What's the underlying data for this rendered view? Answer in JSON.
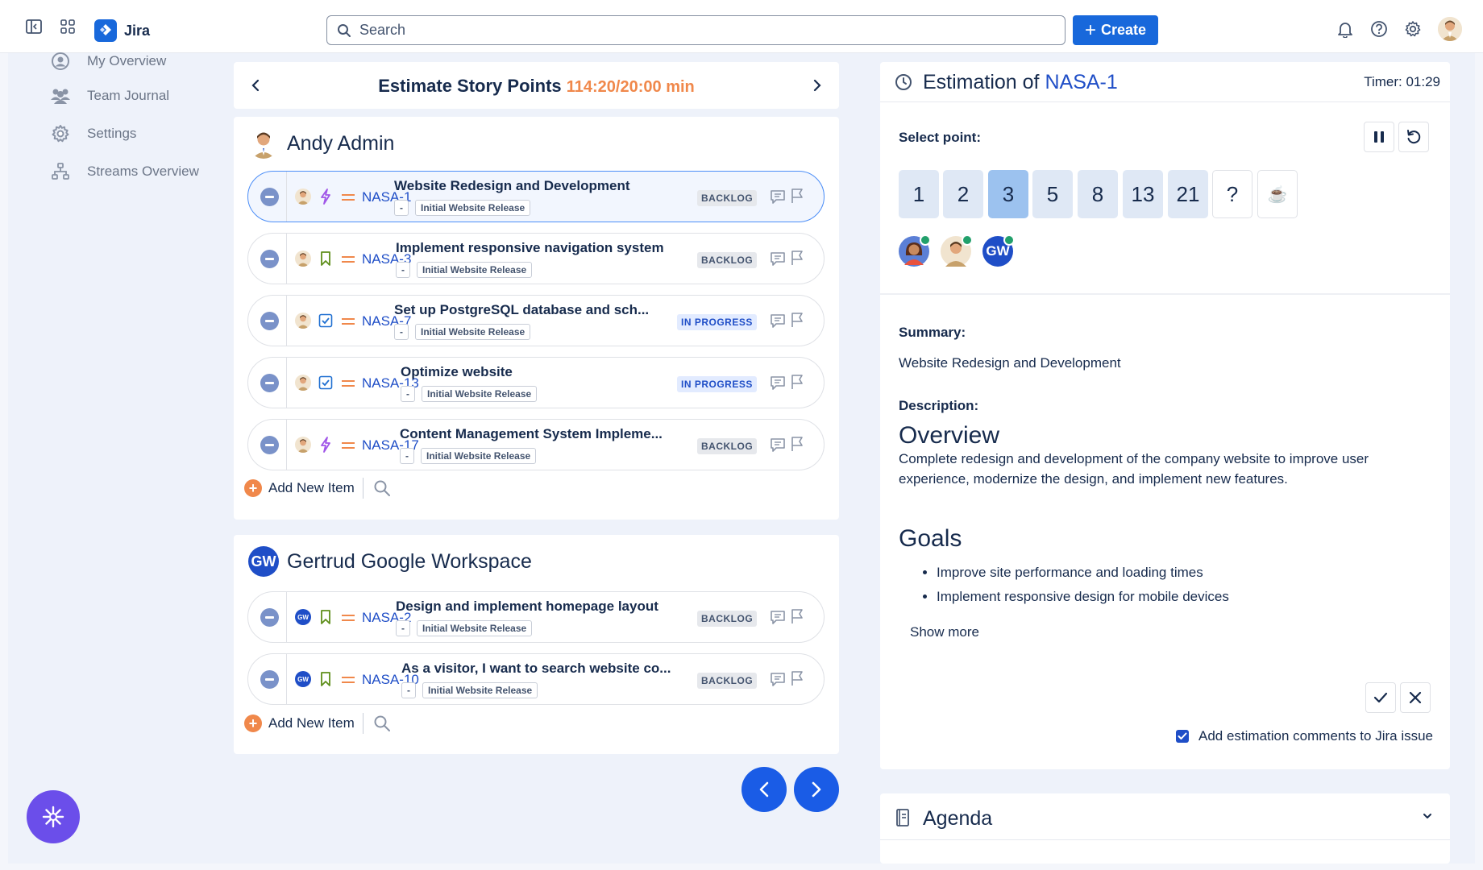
{
  "topbar": {
    "app_name": "Jira",
    "search_placeholder": "Search",
    "create_label": "Create"
  },
  "nav": {
    "items": [
      {
        "label": "My Overview",
        "icon": "person-circle-icon"
      },
      {
        "label": "Team Journal",
        "icon": "team-icon"
      },
      {
        "label": "Settings",
        "icon": "gear-icon"
      },
      {
        "label": "Streams Overview",
        "icon": "hierarchy-icon"
      }
    ]
  },
  "estimate": {
    "title": "Estimate Story Points",
    "timer": "114:20/20:00 min"
  },
  "groups": [
    {
      "name": "Andy Admin",
      "avatar": "andy",
      "add_label": "Add New Item",
      "rows": [
        {
          "key": "NASA-1",
          "summary": "Website Redesign and Development",
          "type": "epic",
          "chip1": "-",
          "chip2": "Initial Website Release",
          "status": "BACKLOG"
        },
        {
          "key": "NASA-3",
          "summary": "Implement responsive navigation system",
          "type": "story",
          "chip1": "-",
          "chip2": "Initial Website Release",
          "status": "BACKLOG"
        },
        {
          "key": "NASA-7",
          "summary": "Set up PostgreSQL database and sch...",
          "type": "task",
          "chip1": "-",
          "chip2": "Initial Website Release",
          "status": "IN PROGRESS"
        },
        {
          "key": "NASA-13",
          "summary": "Optimize website",
          "type": "task",
          "chip1": "-",
          "chip2": "Initial Website Release",
          "status": "IN PROGRESS"
        },
        {
          "key": "NASA-17",
          "summary": "Content Management System Impleme...",
          "type": "epic",
          "chip1": "-",
          "chip2": "Initial Website Release",
          "status": "BACKLOG"
        }
      ]
    },
    {
      "name": "Gertrud Google Workspace",
      "avatar_initials": "GW",
      "add_label": "Add New Item",
      "rows": [
        {
          "key": "NASA-2",
          "summary": "Design and implement homepage layout",
          "type": "story",
          "chip1": "-",
          "chip2": "Initial Website Release",
          "status": "BACKLOG",
          "mini": "GW"
        },
        {
          "key": "NASA-10",
          "summary": "As a visitor, I want to search website co...",
          "type": "story",
          "chip1": "-",
          "chip2": "Initial Website Release",
          "status": "BACKLOG",
          "mini": "GW"
        }
      ]
    }
  ],
  "panel": {
    "title_prefix": "Estimation of",
    "issue_key": "NASA-1",
    "timer": "Timer: 01:29",
    "select_label": "Select point:",
    "points": [
      "1",
      "2",
      "3",
      "5",
      "8",
      "13",
      "21",
      "?",
      "☕"
    ],
    "selected_point": "3",
    "voter_initials": "GW",
    "summary_label": "Summary:",
    "summary_text": "Website Redesign and Development",
    "description_label": "Description:",
    "overview_heading": "Overview",
    "overview_text": "Complete redesign and development of the company website to improve user experience, modernize the design, and implement new features.",
    "goals_heading": "Goals",
    "goals": [
      "Improve site performance and loading times",
      "Implement responsive design for mobile devices"
    ],
    "show_more": "Show more",
    "checkbox_label": "Add estimation comments to Jira issue",
    "checkbox_checked": true
  },
  "agenda": {
    "title": "Agenda"
  },
  "colors": {
    "accent": "#1868db",
    "timer_orange": "#f0884b",
    "fab_purple": "#6b4eea"
  }
}
